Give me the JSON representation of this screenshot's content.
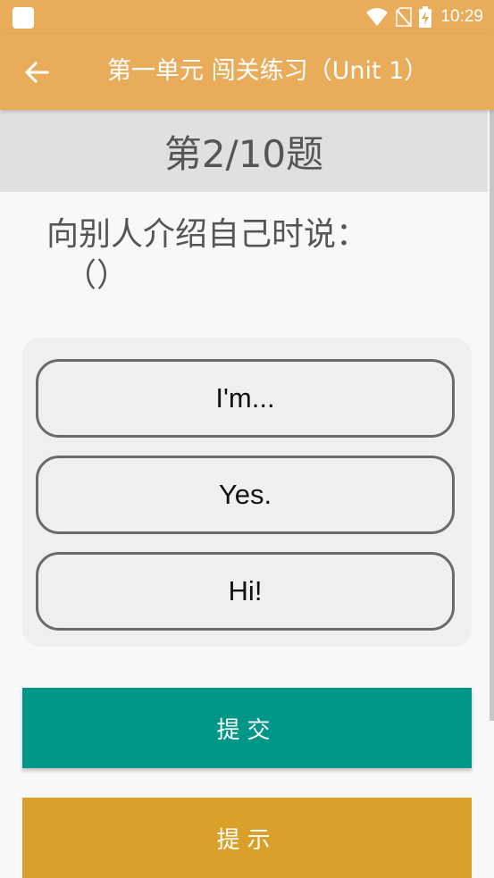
{
  "status_bar": {
    "time": "10:29",
    "icons": [
      "notification-square-icon",
      "wifi-icon",
      "no-sim-icon",
      "battery-charging-icon"
    ]
  },
  "app_bar": {
    "back_icon": "arrow-left-icon",
    "title": "第一单元 闯关练习（Unit 1）"
  },
  "progress": {
    "label": "第2/10题",
    "current": 2,
    "total": 10
  },
  "question": {
    "text": "向别人介绍自己时说：",
    "blank": "（）"
  },
  "options": [
    {
      "label": "I'm..."
    },
    {
      "label": "Yes."
    },
    {
      "label": "Hi!"
    }
  ],
  "actions": {
    "submit_label": "提交",
    "hint_label": "提示"
  },
  "colors": {
    "app_bar": "#e9ac5a",
    "progress_bg": "#e0e0e0",
    "submit": "#009688",
    "hint": "#d9a02a"
  }
}
